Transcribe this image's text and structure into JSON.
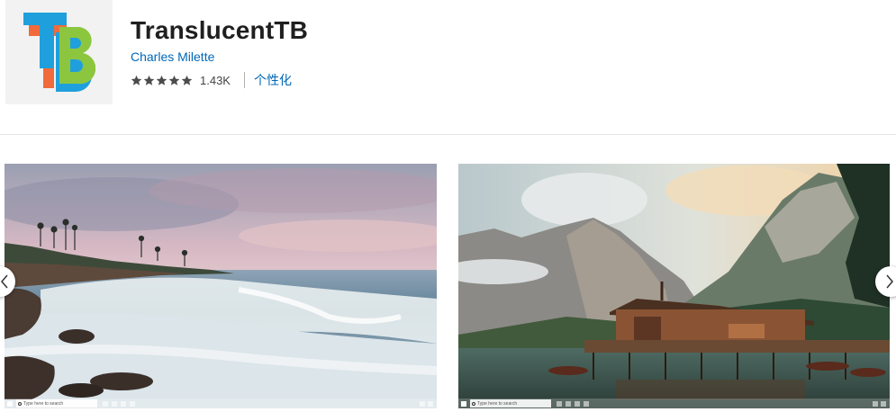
{
  "app": {
    "title": "TranslucentTB",
    "publisher": "Charles Milette",
    "rating_count": "1.43K",
    "rating_value": 5,
    "category": "个性化",
    "logo_letters": "TB",
    "logo_colors": {
      "t_front": "#1fa0dc",
      "t_back": "#f06a3c",
      "b_front": "#8cc63f",
      "b_back": "#1fa0dc"
    }
  },
  "screenshots": [
    {
      "search_placeholder": "Type here to search"
    },
    {
      "search_placeholder": "Type here to search"
    }
  ],
  "colors": {
    "link": "#0067b8",
    "star": "#4c4c4c"
  }
}
